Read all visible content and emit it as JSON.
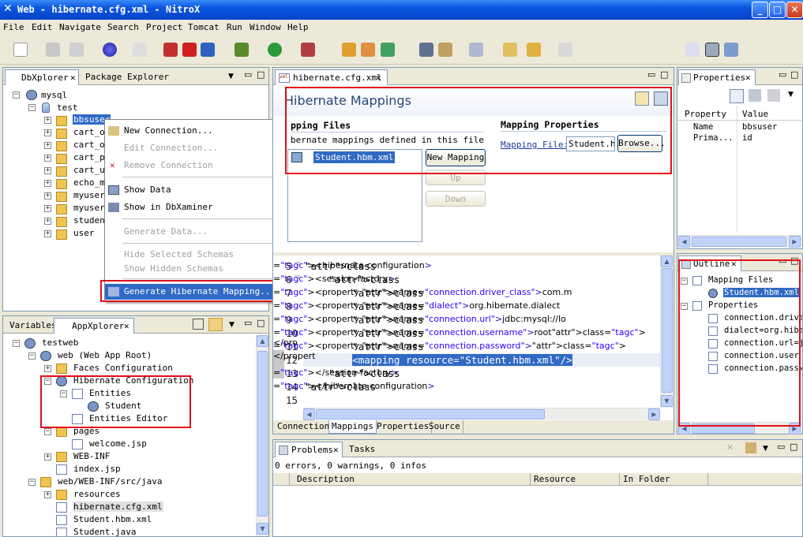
{
  "window": {
    "title": "Web - hibernate.cfg.xml - NitroX",
    "btn_min": "_",
    "btn_max": "□",
    "btn_close": "✕"
  },
  "menu": [
    "File",
    "Edit",
    "Navigate",
    "Search",
    "Project",
    "Tomcat",
    "Run",
    "Window",
    "Help"
  ],
  "dbx": {
    "tabs": [
      "DbXplorer",
      "Package Explorer"
    ],
    "root": "mysql",
    "db": "test",
    "tables": [
      "bbsuser",
      "cart_or",
      "cart_or",
      "cart_pr",
      "cart_us",
      "echo_me",
      "myuser",
      "myuser2",
      "student",
      "user"
    ]
  },
  "context_menu": {
    "items": [
      "New Connection...",
      "Edit Connection...",
      "Remove Connection",
      "Show Data",
      "Show in DbXaminer",
      "Generate Data...",
      "Hide Selected Schemas",
      "Show Hidden Schemas",
      "Generate Hibernate Mapping..."
    ]
  },
  "appx": {
    "tabs": [
      "Variables",
      "AppXplorer"
    ],
    "items": [
      "testweb",
      "web (Web App Root)",
      "Faces Configuration",
      "Hibernate Configuration",
      "Entities",
      "Student",
      "Entities Editor",
      "pages",
      "welcome.jsp",
      "WEB-INF",
      "index.jsp",
      "web/WEB-INF/src/java",
      "resources",
      "hibernate.cfg.xml",
      "Student.hbm.xml",
      "Student.java"
    ]
  },
  "editor": {
    "tab": "hibernate.cfg.xml",
    "heading": "Hibernate Mappings",
    "mapping_files_title": "pping Files",
    "mapping_files_desc": "bernate mappings defined in this file",
    "mapping_file_item": "Student.hbm.xml",
    "btn_new": "New Mapping",
    "btn_up": "Up",
    "btn_down": "Down",
    "mapping_props_title": "Mapping Properties",
    "mapping_file_label": "Mapping File:",
    "mapping_file_value": "Student.hl",
    "btn_browse": "Browse...",
    "line_numbers": [
      "5",
      "6",
      "7",
      "8",
      "9",
      "10",
      "11",
      "12",
      "13",
      "14",
      "15"
    ],
    "code": [
      "<hibernate-configuration>",
      "    <session-factory>",
      "        <property name=\"connection.driver_class\">com.m",
      "        <property name=\"dialect\">org.hibernate.dialect",
      "        <property name=\"connection.url\">jdbc:mysql://lo",
      "        <property name=\"connection.username\">root</pro",
      "        <property name=\"connection.password\"></propert",
      "        <mapping resource=\"Student.hbm.xml\"/>",
      "    </session-factory>",
      "</hibernate-configuration>",
      ""
    ],
    "bottom_tabs": [
      "Connection",
      "Mappings",
      "Properties",
      "Source"
    ]
  },
  "properties": {
    "tab": "Properties",
    "col_property": "Property",
    "col_value": "Value",
    "rows": [
      {
        "k": "Name",
        "v": "bbsuser"
      },
      {
        "k": "Prima...",
        "v": "id"
      }
    ]
  },
  "outline": {
    "tab": "Outline",
    "items": [
      "Mapping Files",
      "Student.hbm.xml",
      "Properties",
      "connection.drive",
      "dialect=org.hibe",
      "connection.url=j",
      "connection.user",
      "connection.passw"
    ]
  },
  "problems": {
    "tabs": [
      "Problems",
      "Tasks"
    ],
    "summary": "0 errors, 0 warnings, 0 infos",
    "cols": [
      "Description",
      "Resource",
      "In Folder"
    ]
  }
}
